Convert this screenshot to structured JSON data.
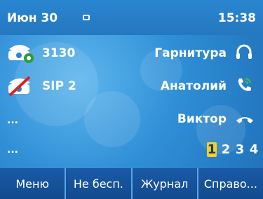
{
  "status": {
    "date": "Июн 30",
    "time": "15:38"
  },
  "lines": [
    {
      "label": "3130",
      "icon": "phone-registered-icon"
    },
    {
      "label": "SIP 2",
      "icon": "phone-unregistered-icon"
    },
    {
      "label": "..."
    },
    {
      "label": "..."
    }
  ],
  "right_items": [
    {
      "label": "Гарнитура",
      "icon": "headset-icon"
    },
    {
      "label": "Анатолий",
      "icon": "phone-ringing-icon"
    },
    {
      "label": "Виктор",
      "icon": "handset-icon"
    }
  ],
  "pages": [
    "1",
    "2",
    "3",
    "4"
  ],
  "active_page": "1",
  "softkeys": [
    "Меню",
    "Не бесп.",
    "Журнал",
    "Справо..."
  ]
}
